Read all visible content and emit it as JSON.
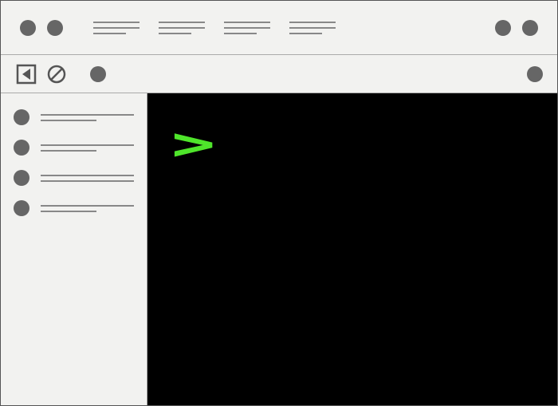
{
  "terminal": {
    "prompt": ">"
  }
}
